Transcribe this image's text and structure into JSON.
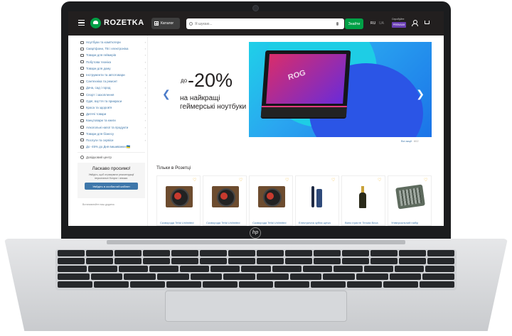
{
  "header": {
    "logo_text": "ROZETKA",
    "catalog_label": "Каталог",
    "search_placeholder": "Я шукаю...",
    "search_button": "Знайти",
    "lang_ru": "RU",
    "lang_ua": "UA",
    "premium_small": "Спробуйте",
    "premium_badge": "PREMIUM"
  },
  "sidebar": {
    "categories": [
      "Ноутбуки та комп'ютери",
      "Смартфони, ТВ і електроніка",
      "Товари для геймерів",
      "Побутова техніка",
      "Товари для дому",
      "Інструменти та автотовари",
      "Сантехніка та ремонт",
      "Дача, сад і город",
      "Спорт і захоплення",
      "Одяг, взуття та прикраси",
      "Краса та здоров'я",
      "Дитячі товари",
      "Канцтовари та книги",
      "Алкогольні напої та продукти",
      "Товари для бізнесу",
      "Послуги та сервіси",
      "До -45% до Дня вишиванки 🇺🇦"
    ],
    "help_center": "Довідковий центр",
    "welcome_title": "Ласкаво просимо!",
    "welcome_text": "Увійдіть, щоб отримувати рекомендації персональні бонуси і знижки.",
    "welcome_button": "Увійдіть в особистий кабінет",
    "footer_text": "Встановлюйте наш додаток"
  },
  "banner": {
    "pre": "до",
    "big": "-20%",
    "line1": "на найкращі",
    "line2": "геймерські ноутбуки",
    "laptop_screen_text": "ROG",
    "all_promos": "Всі акції",
    "all_promos_count": "602"
  },
  "section_title": "Тільки в Розетці",
  "products": [
    {
      "name": "Сковорода Tefal Unlimited",
      "img": "pan"
    },
    {
      "name": "Сковорода Tefal Unlimited",
      "img": "pan"
    },
    {
      "name": "Сковорода Tefal Unlimited",
      "img": "pan"
    },
    {
      "name": "Електрична зубна щітка",
      "img": "toothbrush"
    },
    {
      "name": "Вино ігристе Tenuta Bova",
      "img": "bottle"
    },
    {
      "name": "Універсальний набір",
      "img": "toolkit"
    }
  ],
  "device": {
    "brand": "hp"
  },
  "colors": {
    "brand_green": "#00a046",
    "topbar": "#221f1f",
    "link_blue": "#3e77aa",
    "premium_purple": "#6a3fb5"
  }
}
